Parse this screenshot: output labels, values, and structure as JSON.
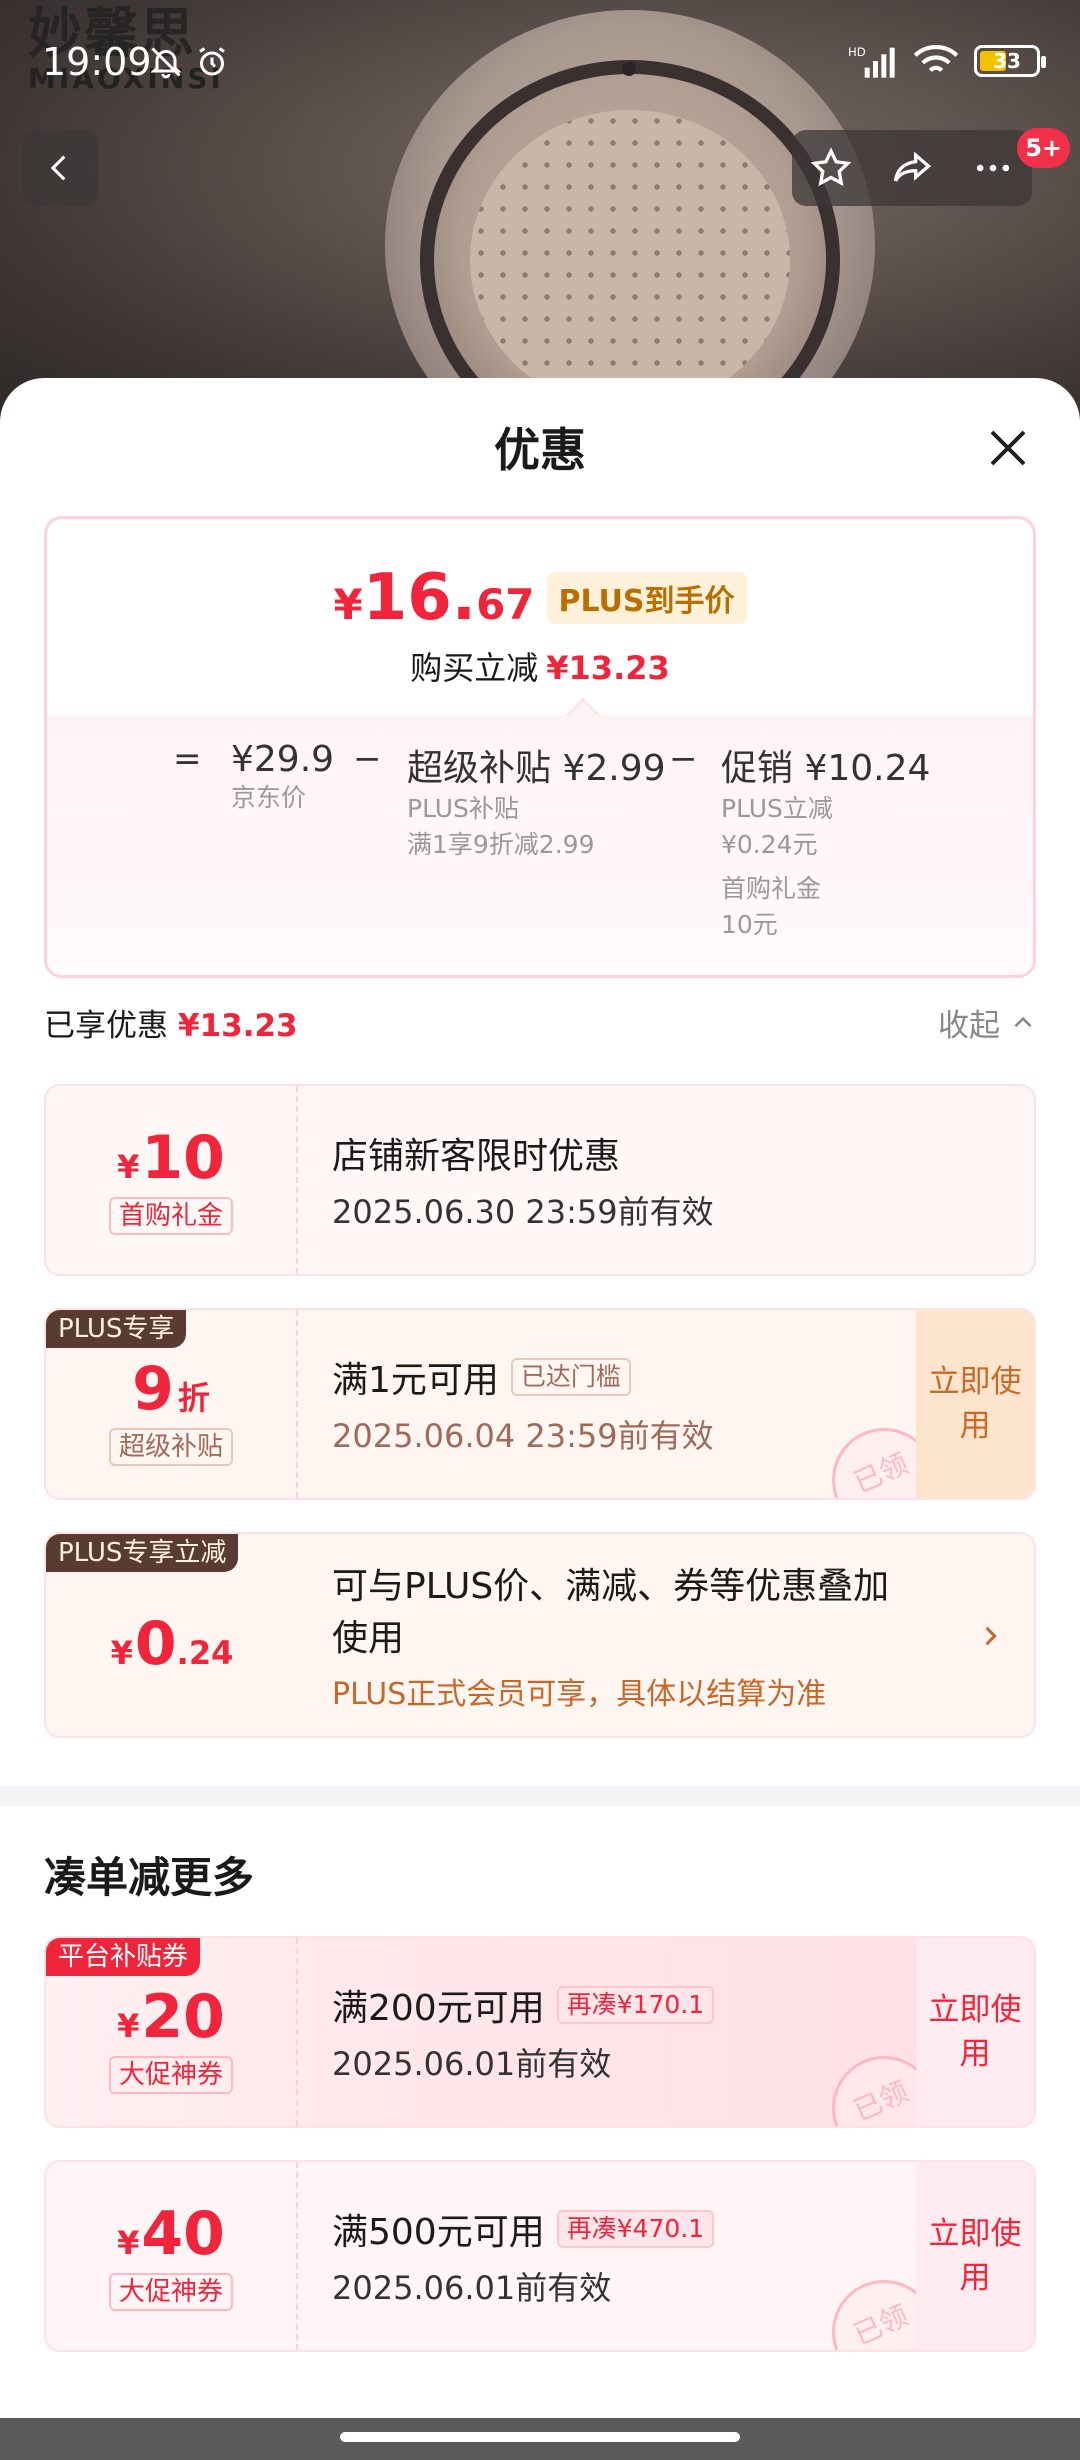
{
  "status_bar": {
    "time": "19:09",
    "battery": "33"
  },
  "brand": {
    "name_cn": "妙馨思",
    "name_en": "MIAOXINSI"
  },
  "nav": {
    "cart_badge": "5+"
  },
  "sheet": {
    "title": "优惠",
    "summary": {
      "price_symbol": "¥",
      "price_int": "16.",
      "price_dec": "67",
      "price_tag": "PLUS到手价",
      "save_label": "购买立减",
      "save_value": "¥13.23",
      "formula": {
        "eq": "=",
        "minus": "−",
        "jd_price": "¥29.9",
        "jd_label": "京东价",
        "subsidy_title": "超级补贴 ¥2.99",
        "subsidy_sub1": "PLUS补贴",
        "subsidy_sub2": "满1享9折减2.99",
        "promo_title": "促销 ¥10.24",
        "promo_sub1": "PLUS立减",
        "promo_sub2": "¥0.24元",
        "promo_sub3": "首购礼金",
        "promo_sub4": "10元"
      }
    },
    "enjoyed": {
      "label": "已享优惠",
      "value": "¥13.23",
      "collapse": "收起"
    },
    "coupons": [
      {
        "symbol": "¥",
        "amount": "10",
        "kind": "首购礼金",
        "title": "店铺新客限时优惠",
        "validity": "2025.06.30 23:59前有效"
      },
      {
        "tag": "PLUS专享",
        "amount": "9",
        "unit": "折",
        "kind": "超级补贴",
        "title": "满1元可用",
        "chip": "已达门槛",
        "validity": "2025.06.04 23:59前有效",
        "action": "立即使用",
        "stamp": "已领"
      },
      {
        "tag": "PLUS专享立减",
        "symbol": "¥",
        "amount": "0",
        "decimal": ".24",
        "title_line1": "可与PLUS价、满减、券等优惠叠加",
        "title_line2": "使用",
        "note": "PLUS正式会员可享，具体以结算为准"
      }
    ],
    "more_section": {
      "title": "凑单减更多"
    },
    "more_coupons": [
      {
        "tag": "平台补贴券",
        "symbol": "¥",
        "amount": "20",
        "kind": "大促神券",
        "title": "满200元可用",
        "chip": "再凑¥170.1",
        "validity": "2025.06.01前有效",
        "action": "立即使用",
        "stamp": "已领"
      },
      {
        "symbol": "¥",
        "amount": "40",
        "kind": "大促神券",
        "title": "满500元可用",
        "chip": "再凑¥470.1",
        "validity": "2025.06.01前有效",
        "action": "立即使用",
        "stamp": "已领"
      }
    ]
  },
  "colors": {
    "accent_red": "#f0243a",
    "plus_tag_bg": "#fff0d9",
    "plus_tag_text": "#b86e00",
    "plus_brown": "#5a3b31"
  }
}
